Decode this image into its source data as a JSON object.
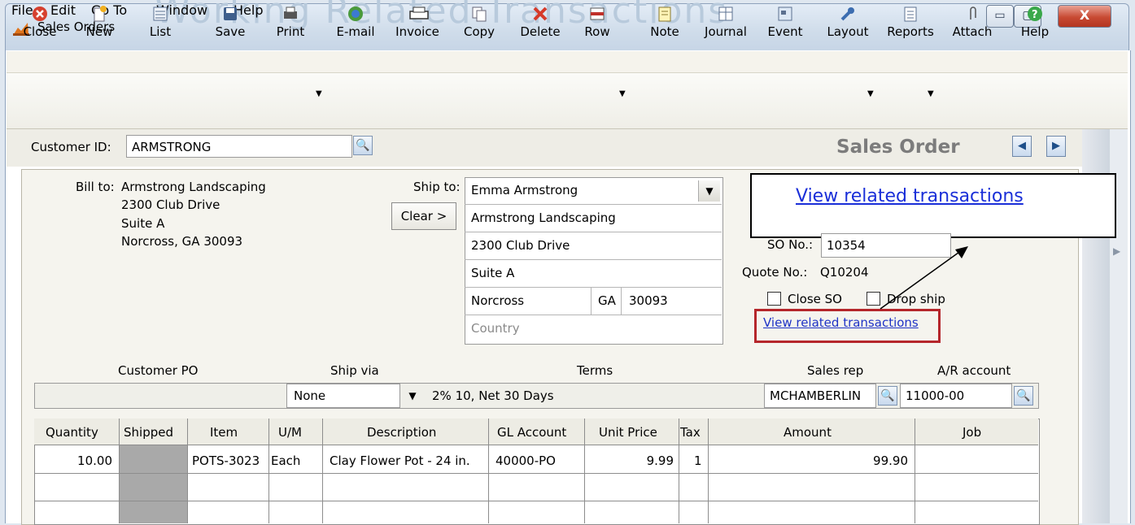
{
  "window": {
    "title": "Sales Orders",
    "background_title": "Working Related Transactions",
    "controls": {
      "minimize": "▭",
      "maximize": "▢",
      "close": "X"
    }
  },
  "menu": [
    "File",
    "Edit",
    "Go To",
    "Window",
    "Help"
  ],
  "toolbar": [
    {
      "label": "Close",
      "icon": "close-icon"
    },
    {
      "label": "New",
      "icon": "new-icon"
    },
    {
      "label": "List",
      "icon": "list-icon"
    },
    {
      "label": "Save",
      "icon": "save-icon"
    },
    {
      "label": "Print",
      "icon": "print-icon"
    },
    {
      "label": "E-mail",
      "icon": "email-icon"
    },
    {
      "label": "Invoice",
      "icon": "invoice-icon"
    },
    {
      "label": "Copy",
      "icon": "copy-icon"
    },
    {
      "label": "Delete",
      "icon": "delete-icon"
    },
    {
      "label": "Row",
      "icon": "row-icon"
    },
    {
      "label": "Note",
      "icon": "note-icon"
    },
    {
      "label": "Journal",
      "icon": "journal-icon"
    },
    {
      "label": "Event",
      "icon": "event-icon"
    },
    {
      "label": "Layout",
      "icon": "layout-icon"
    },
    {
      "label": "Reports",
      "icon": "reports-icon"
    },
    {
      "label": "Attach",
      "icon": "attach-icon"
    },
    {
      "label": "Help",
      "icon": "help-icon"
    }
  ],
  "customer": {
    "label": "Customer ID:",
    "value": "ARMSTRONG"
  },
  "doc_title": "Sales Order",
  "bill_to": {
    "label": "Bill to:",
    "name": "Armstrong Landscaping",
    "line1": "2300 Club Drive",
    "line2": "Suite A",
    "line3": "Norcross, GA 30093"
  },
  "ship_to": {
    "label": "Ship to:",
    "clear_label": "Clear >",
    "contact": "Emma Armstrong",
    "name": "Armstrong Landscaping",
    "address1": "2300 Club Drive",
    "address2": "Suite A",
    "city": "Norcross",
    "state": "GA",
    "zip": "30093",
    "country_placeholder": "Country"
  },
  "callout": {
    "text": "View related transactions"
  },
  "so": {
    "so_label": "SO No.:",
    "so_value": "10354",
    "quote_label": "Quote No.:",
    "quote_value": "Q10204",
    "close_so_label": "Close SO",
    "drop_ship_label": "Drop ship",
    "related_link": "View related transactions"
  },
  "fields": {
    "customer_po_label": "Customer PO",
    "ship_via_label": "Ship via",
    "terms_label": "Terms",
    "sales_rep_label": "Sales rep",
    "ar_account_label": "A/R account",
    "customer_po_value": "",
    "ship_via_value": "None",
    "terms_value": "2% 10, Net 30 Days",
    "sales_rep_value": "MCHAMBERLIN",
    "ar_account_value": "11000-00"
  },
  "table": {
    "columns": [
      "Quantity",
      "Shipped",
      "Item",
      "U/M",
      "Description",
      "GL Account",
      "Unit Price",
      "Tax",
      "Amount",
      "Job"
    ],
    "rows": [
      {
        "quantity": "10.00",
        "shipped": "",
        "item": "POTS-3023",
        "um": "Each",
        "description": "Clay Flower Pot - 24 in.",
        "gl": "40000-PO",
        "unit_price": "9.99",
        "tax": "1",
        "amount": "99.90",
        "job": ""
      }
    ]
  },
  "colors": {
    "accent_red": "#b5262b",
    "link_blue": "#1a2fd8",
    "title_gray": "#7c7c7c"
  }
}
